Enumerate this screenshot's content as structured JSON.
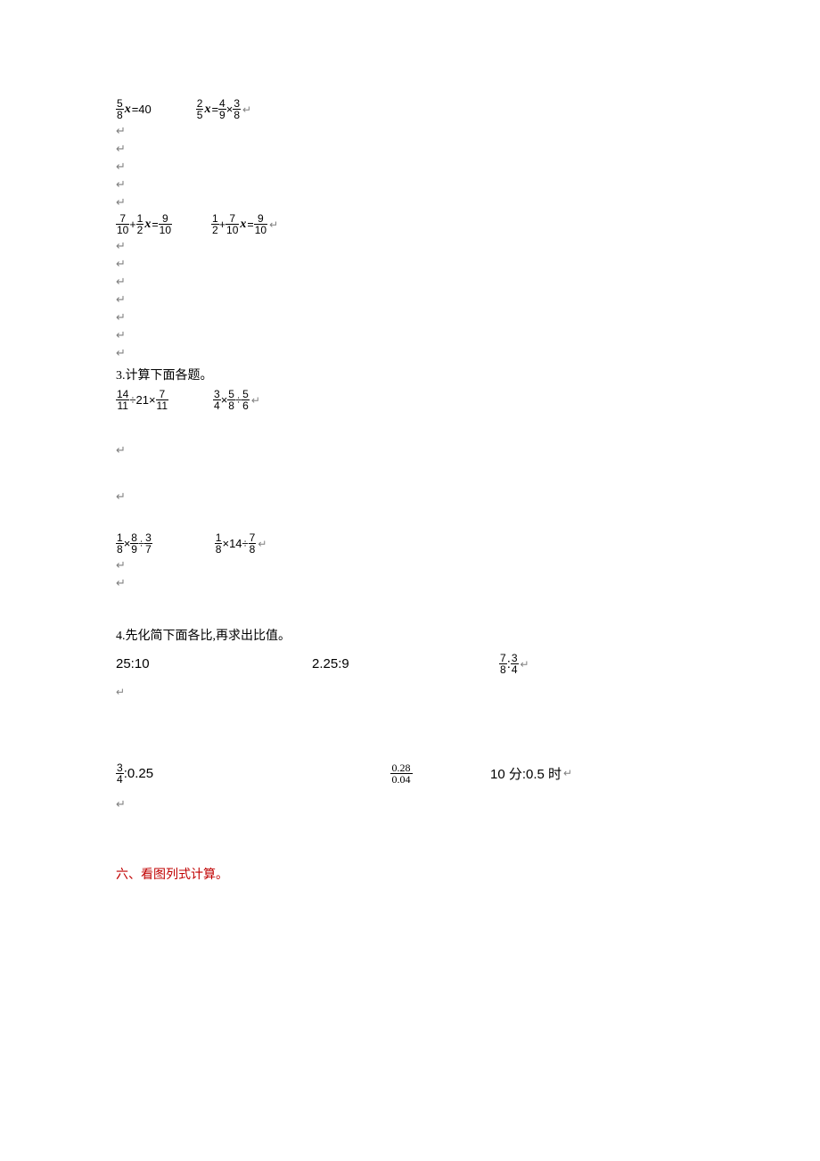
{
  "equations_block1": {
    "eq1": {
      "f1n": "5",
      "f1d": "8",
      "rhs": "=40"
    },
    "eq2": {
      "f1n": "2",
      "f1d": "5",
      "mid": "=",
      "f2n": "4",
      "f2d": "9",
      "op": "×",
      "f3n": "3",
      "f3d": "8"
    }
  },
  "equations_block2": {
    "eq1": {
      "f1n": "7",
      "f1d": "10",
      "op1": "+",
      "f2n": "1",
      "f2d": "2",
      "eq": "=",
      "f3n": "9",
      "f3d": "10"
    },
    "eq2": {
      "f1n": "1",
      "f1d": "2",
      "op1": "+",
      "f2n": "7",
      "f2d": "10",
      "eq": "=",
      "f3n": "9",
      "f3d": "10"
    }
  },
  "heading3": "3.计算下面各题。",
  "calc_block1": {
    "eq1": {
      "f1n": "14",
      "f1d": "11",
      "op1": "÷21×",
      "f2n": "7",
      "f2d": "11"
    },
    "eq2": {
      "f1n": "3",
      "f1d": "4",
      "op1": "×",
      "f2n": "5",
      "f2d": "8",
      "op2": "÷",
      "f3n": "5",
      "f3d": "6"
    }
  },
  "calc_block2": {
    "eq1": {
      "f1n": "1",
      "f1d": "8",
      "op1": "×",
      "f2n": "8",
      "f2d": "9",
      "op2": "÷",
      "f3n": "3",
      "f3d": "7"
    },
    "eq2": {
      "f1n": "1",
      "f1d": "8",
      "op1": "×14÷",
      "f2n": "7",
      "f2d": "8"
    }
  },
  "heading4": "4.先化简下面各比,再求出比值。",
  "ratios_row1": {
    "r1": "25:10",
    "r2": "2.25:9",
    "r3": {
      "f1n": "7",
      "f1d": "8",
      "colon": ":",
      "f2n": "3",
      "f2d": "4"
    }
  },
  "ratios_row2": {
    "r1": {
      "f1n": "3",
      "f1d": "4",
      "rest": ":0.25"
    },
    "r2": {
      "n": "0.28",
      "d": "0.04"
    },
    "r3": "10 分:0.5 时"
  },
  "heading6": "六、看图列式计算。",
  "para_mark": "↵"
}
